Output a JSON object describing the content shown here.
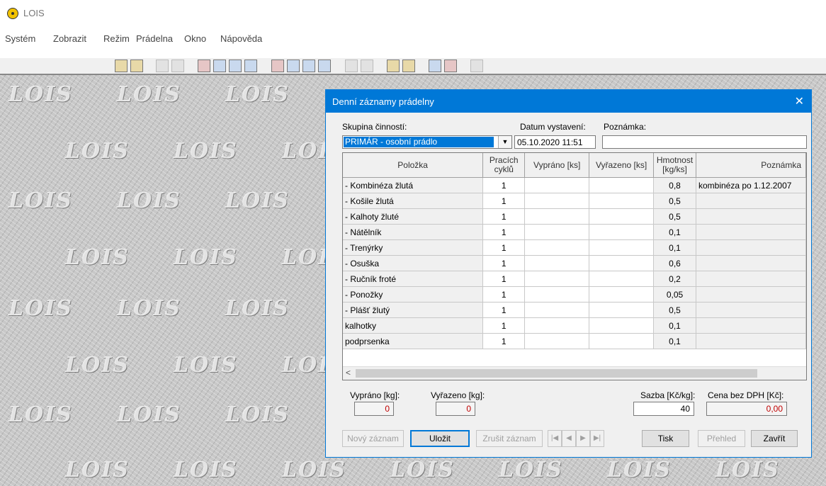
{
  "app": {
    "title": "LOIS",
    "icon": "radiation-icon"
  },
  "menu": [
    "Systém",
    "Zobrazit",
    "Režim",
    "Prádelna",
    "Okno",
    "Nápověda"
  ],
  "desktop": {
    "watermark": "LOIS"
  },
  "dialog": {
    "title": "Denní záznamy prádelny",
    "close": "✕",
    "group_label": "Skupina činností:",
    "group_value": "PRIMÁR - osobní prádlo",
    "date_label": "Datum vystavení:",
    "date_value": "05.10.2020 11:51",
    "note_label": "Poznámka:",
    "note_value": "",
    "columns": [
      "Položka",
      "Pracích cyklů",
      "Vypráno [ks]",
      "Vyřazeno [ks]",
      "Hmotnost [kg/ks]",
      "Poznámka"
    ],
    "rows": [
      {
        "item": "- Kombinéza žlutá",
        "cycles": "1",
        "washed": "",
        "discarded": "",
        "weight": "0,8",
        "note": "kombinéza po 1.12.2007"
      },
      {
        "item": "- Košile žlutá",
        "cycles": "1",
        "washed": "",
        "discarded": "",
        "weight": "0,5",
        "note": ""
      },
      {
        "item": "- Kalhoty žluté",
        "cycles": "1",
        "washed": "",
        "discarded": "",
        "weight": "0,5",
        "note": ""
      },
      {
        "item": "- Nátělník",
        "cycles": "1",
        "washed": "",
        "discarded": "",
        "weight": "0,1",
        "note": ""
      },
      {
        "item": "- Trenýrky",
        "cycles": "1",
        "washed": "",
        "discarded": "",
        "weight": "0,1",
        "note": ""
      },
      {
        "item": "- Osuška",
        "cycles": "1",
        "washed": "",
        "discarded": "",
        "weight": "0,6",
        "note": ""
      },
      {
        "item": "- Ručník froté",
        "cycles": "1",
        "washed": "",
        "discarded": "",
        "weight": "0,2",
        "note": ""
      },
      {
        "item": "- Ponožky",
        "cycles": "1",
        "washed": "",
        "discarded": "",
        "weight": "0,05",
        "note": ""
      },
      {
        "item": "- Plášť žlutý",
        "cycles": "1",
        "washed": "",
        "discarded": "",
        "weight": "0,5",
        "note": ""
      },
      {
        "item": "kalhotky",
        "cycles": "1",
        "washed": "",
        "discarded": "",
        "weight": "0,1",
        "note": ""
      },
      {
        "item": "podprsenka",
        "cycles": "1",
        "washed": "",
        "discarded": "",
        "weight": "0,1",
        "note": ""
      }
    ],
    "scroll_left": "<",
    "totals": {
      "washed_label": "Vypráno [kg]:",
      "washed_value": "0",
      "discarded_label": "Vyřazeno [kg]:",
      "discarded_value": "0",
      "rate_label": "Sazba [Kč/kg]:",
      "rate_value": "40",
      "price_label": "Cena bez DPH [Kč]:",
      "price_value": "0,00"
    },
    "buttons": {
      "new": "Nový záznam",
      "save": "Uložit",
      "cancel": "Zrušit záznam",
      "print": "Tisk",
      "overview": "Přehled",
      "close": "Zavřít"
    }
  }
}
